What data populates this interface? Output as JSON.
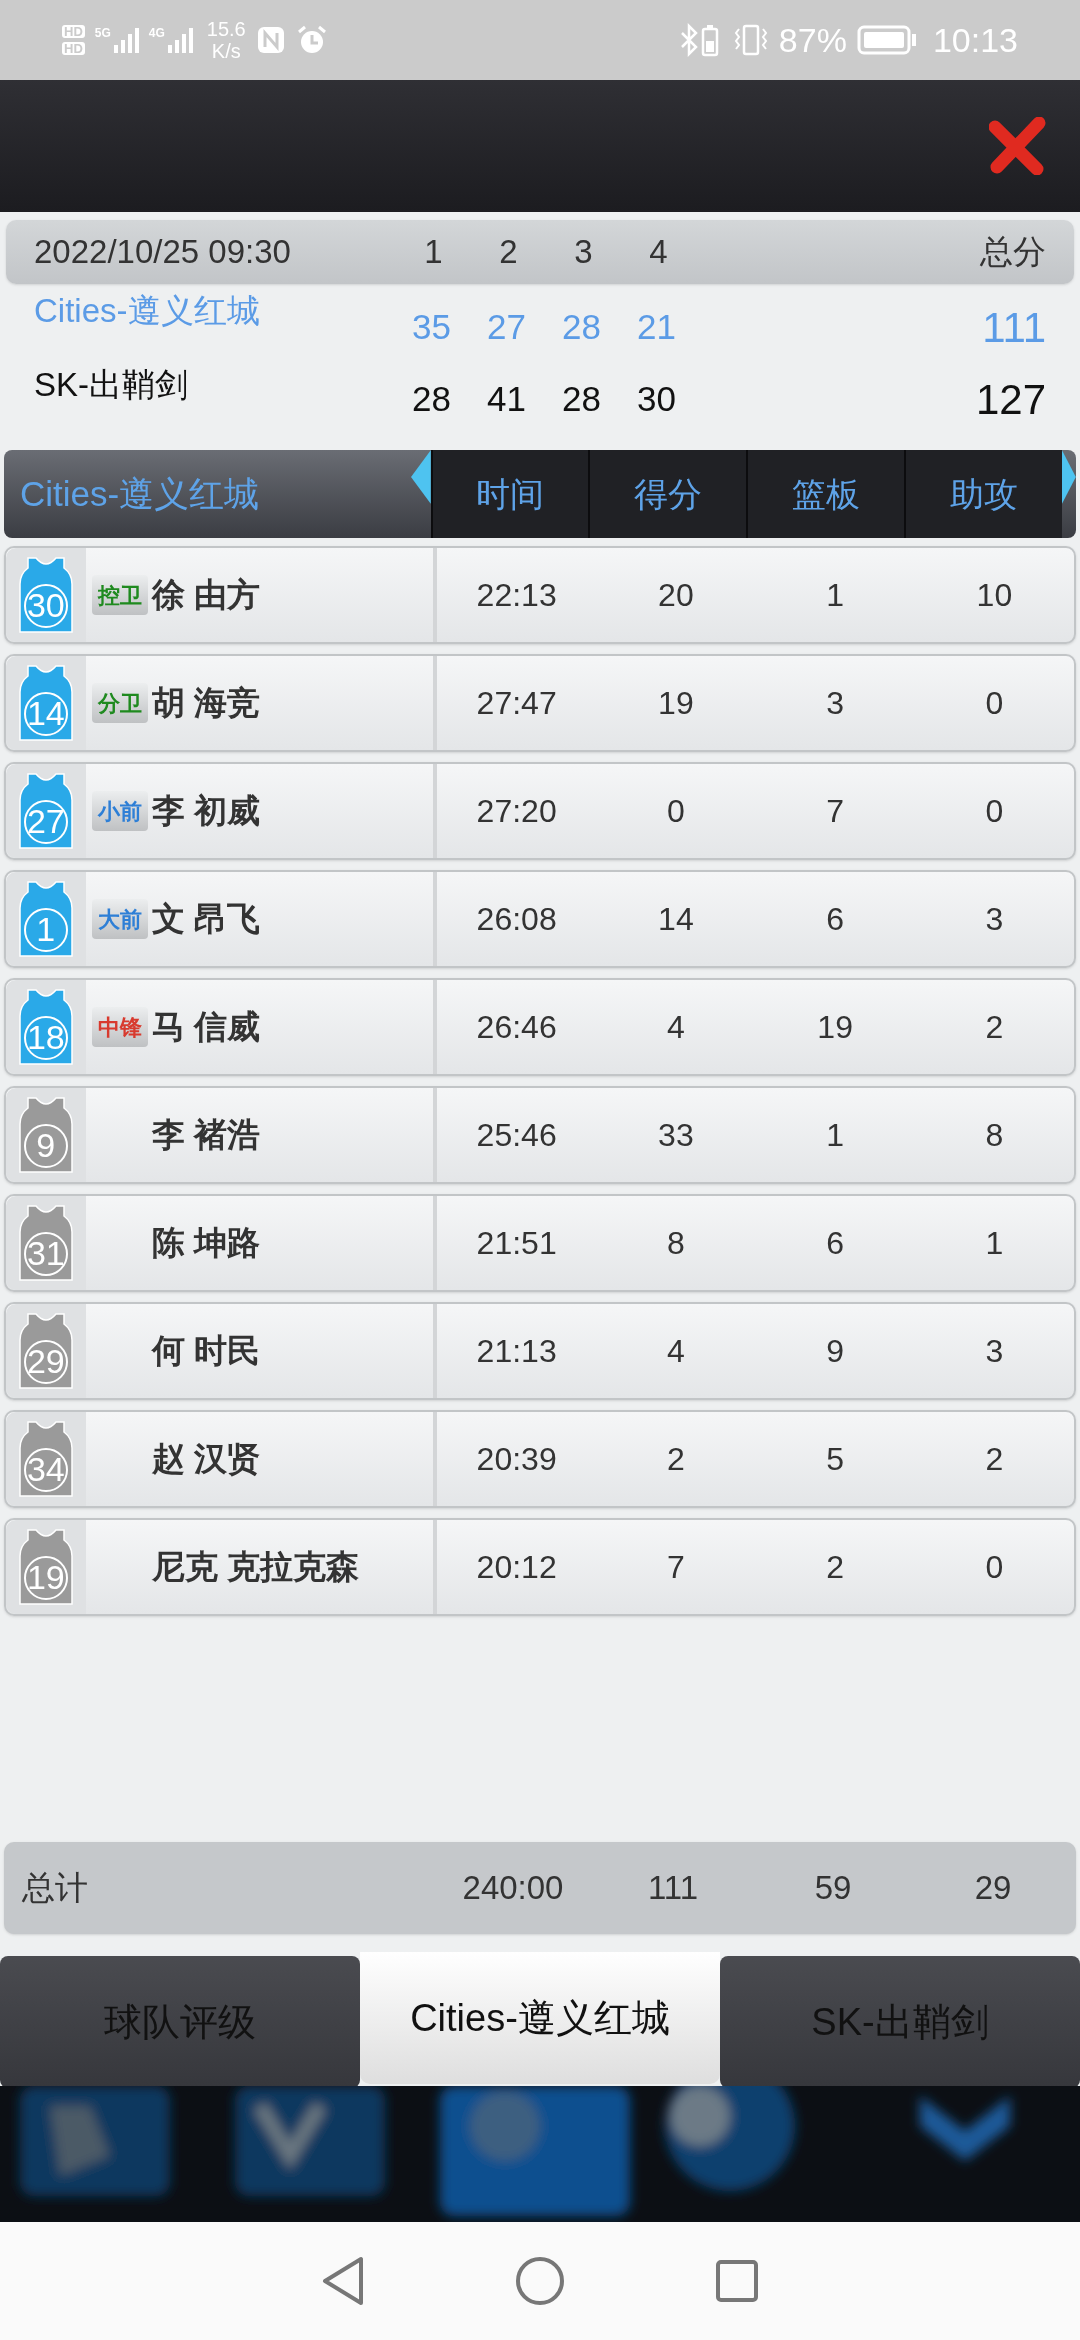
{
  "status_bar": {
    "sim_labels": [
      "HD",
      "HD"
    ],
    "networks": [
      "5G",
      "4G"
    ],
    "speed": "15.6",
    "speed_unit": "K/s",
    "battery": "87%",
    "time": "10:13"
  },
  "scoreboard": {
    "date": "2022/10/25 09:30",
    "quarters": [
      "1",
      "2",
      "3",
      "4"
    ],
    "total_label": "总分",
    "teams": [
      {
        "name": "Cities-遵义红城",
        "highlighted": true,
        "scores": [
          "35",
          "27",
          "28",
          "21"
        ],
        "total": "111"
      },
      {
        "name": "SK-出鞘剑",
        "highlighted": false,
        "scores": [
          "28",
          "41",
          "28",
          "30"
        ],
        "total": "127"
      }
    ]
  },
  "stats_table": {
    "team": "Cities-遵义红城",
    "columns": [
      "时间",
      "得分",
      "篮板",
      "助攻"
    ],
    "rows": [
      {
        "number": "30",
        "starter": true,
        "position": {
          "label": "控卫",
          "color": "#1f8a1f"
        },
        "name": "徐 由方",
        "values": [
          "22:13",
          "20",
          "1",
          "10"
        ]
      },
      {
        "number": "14",
        "starter": true,
        "position": {
          "label": "分卫",
          "color": "#1f8a1f"
        },
        "name": "胡 海竞",
        "values": [
          "27:47",
          "19",
          "3",
          "0"
        ]
      },
      {
        "number": "27",
        "starter": true,
        "position": {
          "label": "小前",
          "color": "#2e7fd6"
        },
        "name": "李 初威",
        "values": [
          "27:20",
          "0",
          "7",
          "0"
        ]
      },
      {
        "number": "1",
        "starter": true,
        "position": {
          "label": "大前",
          "color": "#2e7fd6"
        },
        "name": "文 昂飞",
        "values": [
          "26:08",
          "14",
          "6",
          "3"
        ]
      },
      {
        "number": "18",
        "starter": true,
        "position": {
          "label": "中锋",
          "color": "#d83a2e"
        },
        "name": "马 信威",
        "values": [
          "26:46",
          "4",
          "19",
          "2"
        ]
      },
      {
        "number": "9",
        "starter": false,
        "name": "李 褚浩",
        "values": [
          "25:46",
          "33",
          "1",
          "8"
        ]
      },
      {
        "number": "31",
        "starter": false,
        "name": "陈 坤路",
        "values": [
          "21:51",
          "8",
          "6",
          "1"
        ]
      },
      {
        "number": "29",
        "starter": false,
        "name": "何 时民",
        "values": [
          "21:13",
          "4",
          "9",
          "3"
        ]
      },
      {
        "number": "34",
        "starter": false,
        "name": "赵 汉贤",
        "values": [
          "20:39",
          "2",
          "5",
          "2"
        ]
      },
      {
        "number": "19",
        "starter": false,
        "name": "尼克 克拉克森",
        "values": [
          "20:12",
          "7",
          "2",
          "0"
        ]
      }
    ],
    "totals": {
      "label": "总计",
      "values": [
        "240:00",
        "111",
        "59",
        "29"
      ]
    }
  },
  "tabs": [
    {
      "label": "球队评级",
      "selected": false
    },
    {
      "label": "Cities-遵义红城",
      "selected": true
    },
    {
      "label": "SK-出鞘剑",
      "selected": false
    }
  ]
}
